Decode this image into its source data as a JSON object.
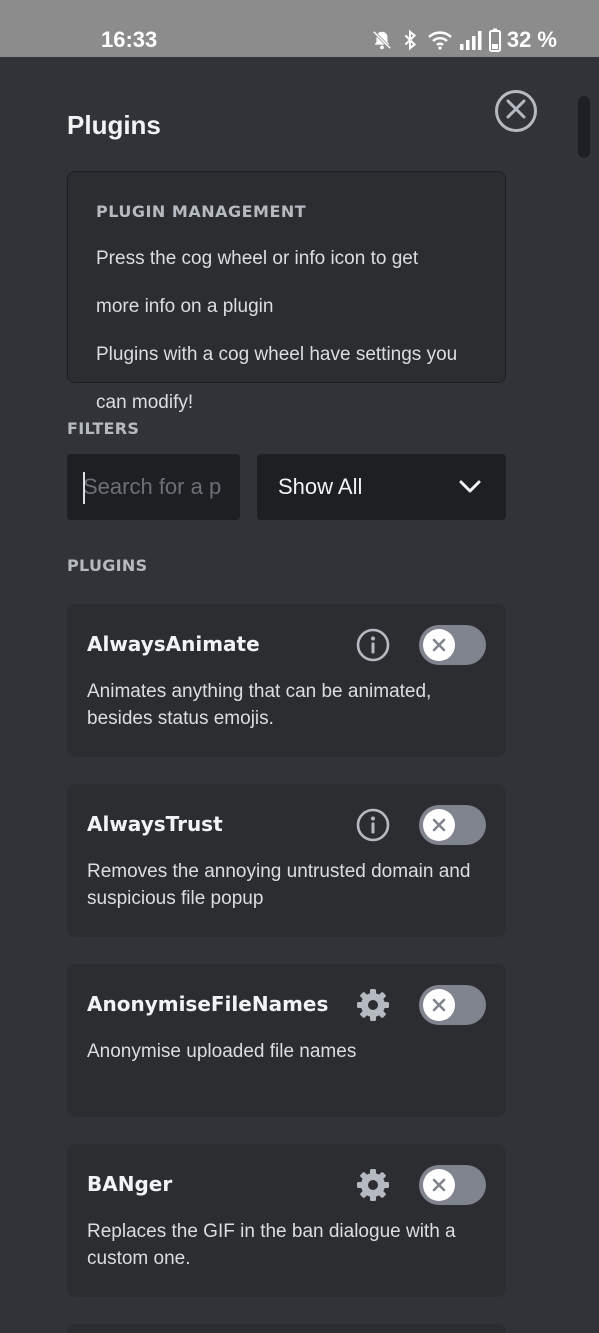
{
  "status_bar": {
    "time": "16:33",
    "battery": "32 %"
  },
  "modal": {
    "title": "Plugins",
    "info": {
      "heading": "PLUGIN MANAGEMENT",
      "line1": "Press the cog wheel or info icon to get",
      "line2": "more info on a plugin",
      "line3": "Plugins with a cog wheel have settings you",
      "line4": "can modify!"
    },
    "filters": {
      "label": "FILTERS",
      "search_placeholder": "Search for a p",
      "search_value": "",
      "select_value": "Show All"
    },
    "plugins_label": "PLUGINS",
    "plugins": [
      {
        "name": "AlwaysAnimate",
        "description": "Animates anything that can be animated, besides status emojis.",
        "icon": "info-icon",
        "enabled": false
      },
      {
        "name": "AlwaysTrust",
        "description": "Removes the annoying untrusted domain and suspicious file popup",
        "icon": "info-icon",
        "enabled": false
      },
      {
        "name": "AnonymiseFileNames",
        "description": "Anonymise uploaded file names",
        "icon": "cog-icon",
        "enabled": false
      },
      {
        "name": "BANger",
        "description": "Replaces the GIF in the ban dialogue with a custom one.",
        "icon": "cog-icon",
        "enabled": false
      }
    ]
  },
  "colors": {
    "background": "#313338",
    "card": "#2b2d31",
    "input": "#1e1f22",
    "toggle_off": "#80848e",
    "status_bar": "#8c8c8c"
  }
}
